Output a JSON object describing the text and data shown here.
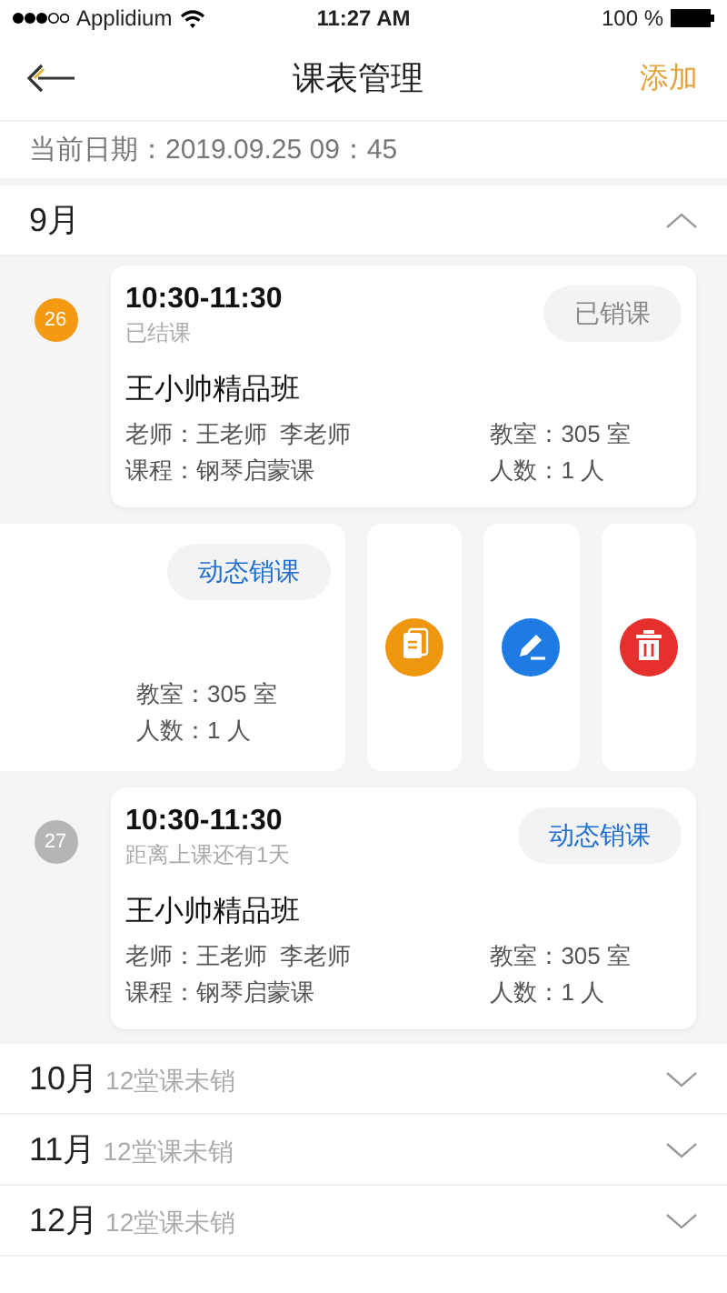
{
  "status_bar": {
    "carrier": "Applidium",
    "time": "11:27 AM",
    "battery": "100 %"
  },
  "nav": {
    "title": "课表管理",
    "action": "添加"
  },
  "current_date": "当前日期：2019.09.25  09：45",
  "months": [
    {
      "label": "9月",
      "expanded": true,
      "lessons": [
        {
          "kind": "card",
          "day": "26",
          "active": true,
          "time": "10:30-11:30",
          "status": "已结课",
          "button": {
            "label": "已销课",
            "disabled": true
          },
          "class_name": "王小帅精品班",
          "teacher": "老师：王老师  李老师",
          "course": "课程：钢琴启蒙课",
          "room": "教室：305 室",
          "count": "人数：1 人"
        },
        {
          "kind": "swiped",
          "button": {
            "label": "动态销课",
            "disabled": false
          },
          "room": "教室：305 室",
          "count": "人数：1 人",
          "actions": [
            {
              "kind": "copy",
              "color": "#ef960f"
            },
            {
              "kind": "edit",
              "color": "#1e7be3"
            },
            {
              "kind": "delete",
              "color": "#e5302d"
            }
          ]
        },
        {
          "kind": "card",
          "day": "27",
          "active": false,
          "time": "10:30-11:30",
          "status": "距离上课还有1天",
          "button": {
            "label": "动态销课",
            "disabled": false
          },
          "class_name": "王小帅精品班",
          "teacher": "老师：王老师  李老师",
          "course": "课程：钢琴启蒙课",
          "room": "教室：305 室",
          "count": "人数：1 人"
        }
      ]
    },
    {
      "label": "10月",
      "summary": "12堂课未销",
      "expanded": false
    },
    {
      "label": "11月",
      "summary": "12堂课未销",
      "expanded": false
    },
    {
      "label": "12月",
      "summary": "12堂课未销",
      "expanded": false
    }
  ]
}
